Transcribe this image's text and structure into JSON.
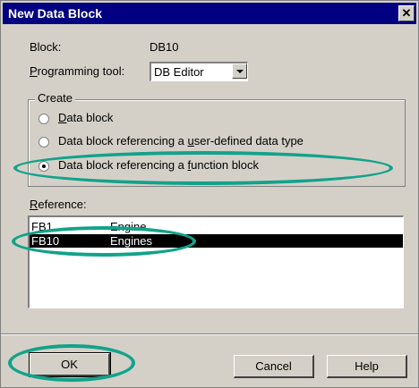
{
  "dialog": {
    "title": "New Data Block"
  },
  "block": {
    "label": "Block:",
    "value": "DB10"
  },
  "programming_tool": {
    "label_prefix": "",
    "label_mnemonic": "P",
    "label_rest": "rogramming tool:",
    "selected": "DB Editor"
  },
  "create": {
    "title": "Create",
    "options": [
      {
        "mnemonic": "D",
        "rest": "ata block",
        "checked": false
      },
      {
        "prefix": "Data block referencing a ",
        "mnemonic": "u",
        "rest": "ser-defined data type",
        "checked": false
      },
      {
        "prefix": "Data block referencing a ",
        "mnemonic": "f",
        "rest": "unction block",
        "checked": true
      }
    ]
  },
  "reference": {
    "mnemonic": "R",
    "rest": "eference:",
    "rows": [
      {
        "id": "FB1",
        "name": "Engine"
      },
      {
        "id": "FB10",
        "name": "Engines"
      }
    ],
    "selected_index": 1
  },
  "buttons": {
    "ok": "OK",
    "cancel": "Cancel",
    "help": "Help"
  },
  "highlight_color": "#12a28a"
}
